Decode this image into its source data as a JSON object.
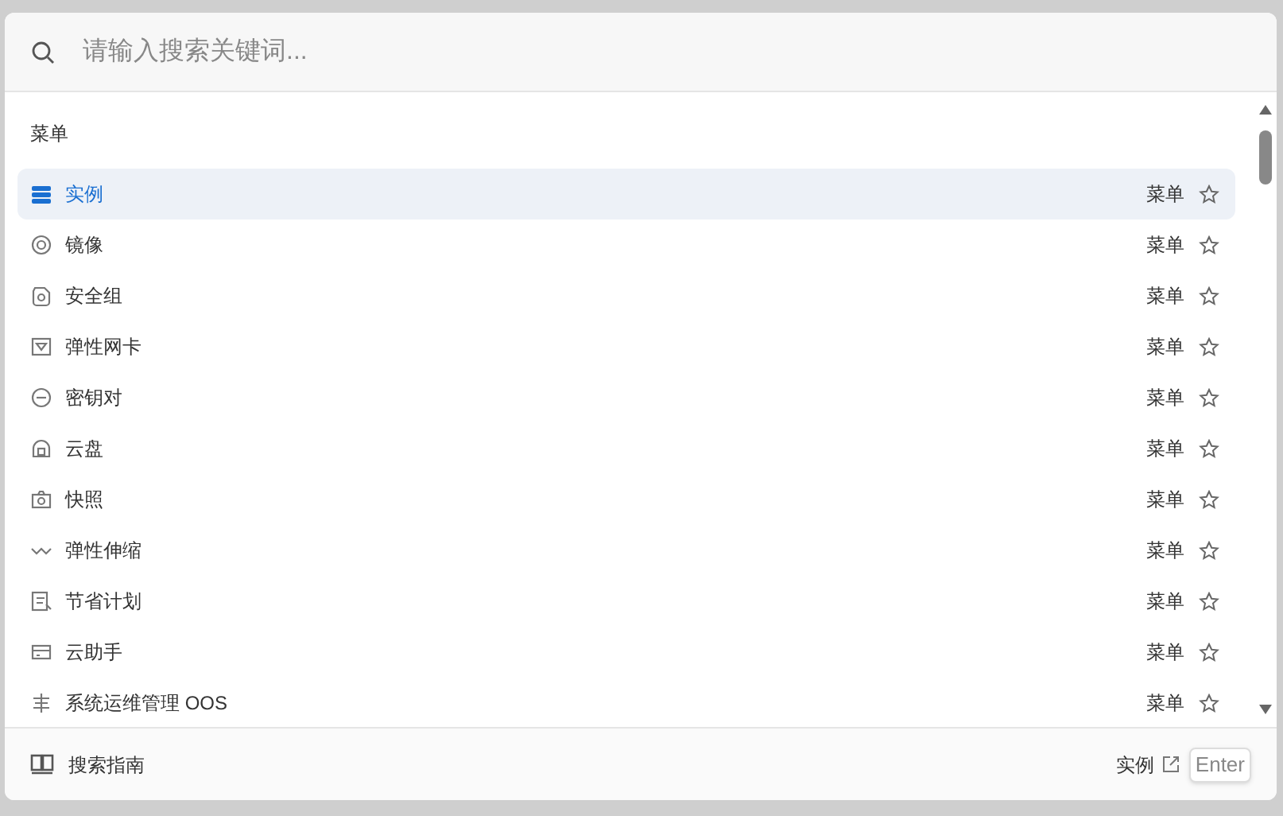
{
  "search": {
    "placeholder": "请输入搜索关键词..."
  },
  "section": {
    "title": "菜单"
  },
  "items": [
    {
      "label": "实例",
      "category": "菜单",
      "selected": true,
      "starred": false
    },
    {
      "label": "镜像",
      "category": "菜单",
      "selected": false,
      "starred": false
    },
    {
      "label": "安全组",
      "category": "菜单",
      "selected": false,
      "starred": false
    },
    {
      "label": "弹性网卡",
      "category": "菜单",
      "selected": false,
      "starred": false
    },
    {
      "label": "密钥对",
      "category": "菜单",
      "selected": false,
      "starred": false
    },
    {
      "label": "云盘",
      "category": "菜单",
      "selected": false,
      "starred": false
    },
    {
      "label": "快照",
      "category": "菜单",
      "selected": false,
      "starred": false
    },
    {
      "label": "弹性伸缩",
      "category": "菜单",
      "selected": false,
      "starred": false
    },
    {
      "label": "节省计划",
      "category": "菜单",
      "selected": false,
      "starred": false
    },
    {
      "label": "云助手",
      "category": "菜单",
      "selected": false,
      "starred": false
    },
    {
      "label": "系统运维管理 OOS",
      "category": "菜单",
      "selected": false,
      "starred": false
    }
  ],
  "footer": {
    "guide": "搜索指南",
    "target": "实例",
    "key": "Enter"
  }
}
